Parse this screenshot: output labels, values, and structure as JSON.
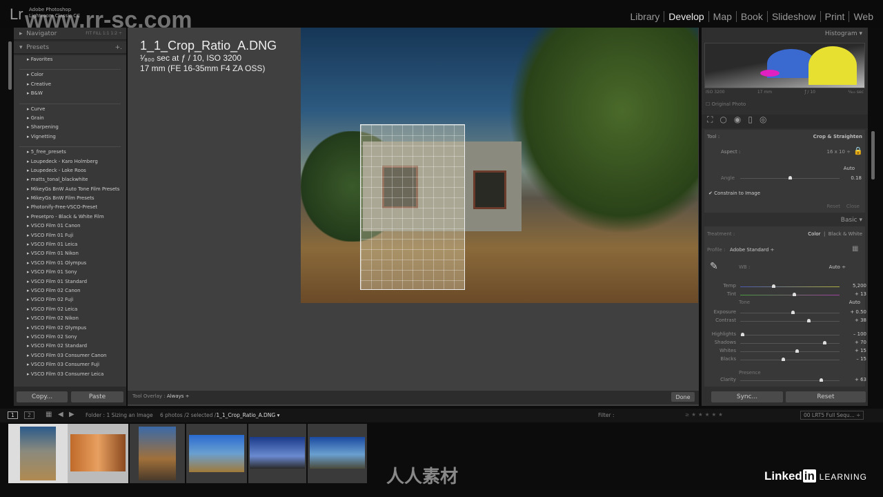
{
  "app": {
    "vendor": "Adobe Photoshop",
    "name": "Lightroom Classic CC",
    "logo": "Lr",
    "watermark": "www.rr-sc.com"
  },
  "modules": [
    {
      "label": "Library"
    },
    {
      "label": "Develop",
      "active": true
    },
    {
      "label": "Map"
    },
    {
      "label": "Book"
    },
    {
      "label": "Slideshow"
    },
    {
      "label": "Print"
    },
    {
      "label": "Web"
    }
  ],
  "navigator": {
    "label": "Navigator",
    "zoom": [
      "FIT",
      "FILL",
      "1:1",
      "1:2 ÷"
    ]
  },
  "presets": {
    "label": "Presets",
    "add": "+.",
    "groups": [
      [
        "Favorites"
      ],
      [
        "Color",
        "Creative",
        "B&W"
      ],
      [
        "Curve",
        "Grain",
        "Sharpening",
        "Vignetting"
      ],
      [
        "5_free_presets",
        "Loupedeck - Karo Holmberg",
        "Loupedeck - Loke Roos",
        "matts_tonal_blackwhite",
        "MikeyGs BnW Auto Tone Film Presets",
        "MikeyGs BnW Film Presets",
        "Photonify-Free-VSCO-Preset",
        "Presetpro - Black & White Film",
        "VSCO Film 01 Canon",
        "VSCO Film 01 Fuji",
        "VSCO Film 01 Leica",
        "VSCO Film 01 Nikon",
        "VSCO Film 01 Olympus",
        "VSCO Film 01 Sony",
        "VSCO Film 01 Standard",
        "VSCO Film 02 Canon",
        "VSCO Film 02 Fuji",
        "VSCO Film 02 Leica",
        "VSCO Film 02 Nikon",
        "VSCO Film 02 Olympus",
        "VSCO Film 02 Sony",
        "VSCO Film 02 Standard",
        "VSCO Film 03 Consumer Canon",
        "VSCO Film 03 Consumer Fuji",
        "VSCO Film 03 Consumer Leica"
      ]
    ]
  },
  "left_buttons": {
    "copy": "Copy...",
    "paste": "Paste"
  },
  "photo_info": {
    "filename": "1_1_Crop_Ratio_A.DNG",
    "exposure": "¹⁄₈₀₀ sec at ƒ / 10, ISO 3200",
    "lens": "17 mm (FE 16-35mm F4 ZA OSS)"
  },
  "toolbar": {
    "overlay_label": "Tool Overlay :",
    "overlay_value": "Always ÷",
    "done": "Done"
  },
  "histogram": {
    "label": "Histogram",
    "iso": "ISO 3200",
    "focal": "17 mm",
    "aperture": "ƒ / 10",
    "shutter": "¹⁄₈₀₀ sec",
    "original": "Original Photo"
  },
  "crop": {
    "tool_label": "Tool :",
    "tool_name": "Crop & Straighten",
    "aspect_label": "Aspect :",
    "aspect_value": "16 x 10 ÷",
    "auto": "Auto",
    "angle_label": "Angle",
    "angle_value": "0.18",
    "angle_pos": 0.5,
    "constrain": "Constrain to Image",
    "constrain_checked": true,
    "reset": "Reset",
    "close": "Close"
  },
  "basic": {
    "label": "Basic",
    "treatment_label": "Treatment :",
    "color": "Color",
    "bw": "Black & White",
    "profile_label": "Profile :",
    "profile": "Adobe Standard ÷",
    "wb_label": "WB :",
    "wb_value": "Auto ÷",
    "tone_label": "Tone",
    "tone_auto": "Auto",
    "presence_label": "Presence",
    "sliders": [
      {
        "label": "Temp",
        "value": "5,200",
        "pos": 0.33
      },
      {
        "label": "Tint",
        "value": "+ 13",
        "pos": 0.54
      },
      {
        "label": "Exposure",
        "value": "+ 0.50",
        "pos": 0.53
      },
      {
        "label": "Contrast",
        "value": "+ 38",
        "pos": 0.69
      },
      {
        "label": "Highlights",
        "value": "– 100",
        "pos": 0.02
      },
      {
        "label": "Shadows",
        "value": "+ 70",
        "pos": 0.85
      },
      {
        "label": "Whites",
        "value": "+ 15",
        "pos": 0.57
      },
      {
        "label": "Blacks",
        "value": "– 15",
        "pos": 0.43
      },
      {
        "label": "Clarity",
        "value": "+ 63",
        "pos": 0.81
      }
    ]
  },
  "right_buttons": {
    "sync": "Sync...",
    "reset": "Reset"
  },
  "filmstrip": {
    "view1": "1",
    "view2": "2",
    "folder": "Folder : 1 Sizing an Image",
    "count": "6 photos /2 selected /",
    "current": "1_1_Crop_Ratio_A.DNG ▾",
    "filter": "Filter :",
    "filter_preset": "00 LRT5 Full Sequ... ÷"
  },
  "branding": {
    "linkedin": "Linked",
    "in": "in",
    "learning": "LEARNING",
    "rr": "人人素材"
  }
}
